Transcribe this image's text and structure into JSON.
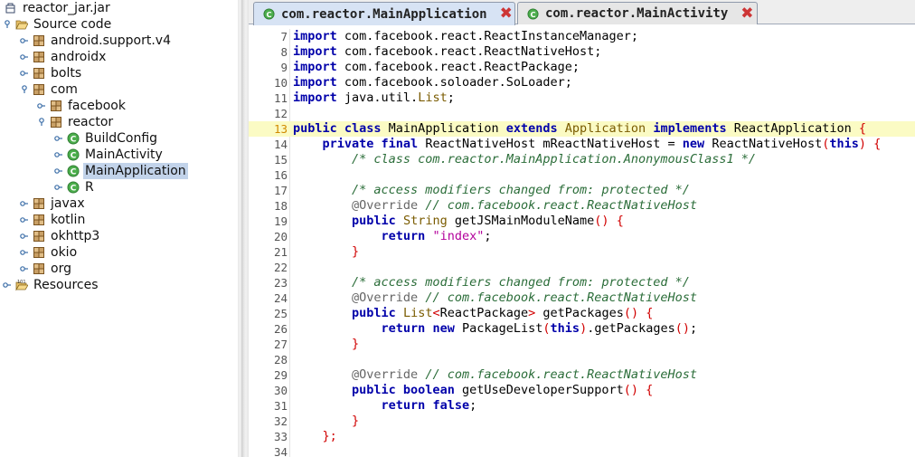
{
  "project_tree": {
    "nodes": [
      {
        "label": "reactor_jar.jar",
        "icon": "jar-icon",
        "depth": 0,
        "toggle": "none",
        "selected": false
      },
      {
        "label": "Source code",
        "icon": "folder-open-icon",
        "depth": 1,
        "toggle": "expanded",
        "selected": false
      },
      {
        "label": "android.support.v4",
        "icon": "package-icon",
        "depth": 2,
        "toggle": "collapsed",
        "selected": false
      },
      {
        "label": "androidx",
        "icon": "package-icon",
        "depth": 2,
        "toggle": "collapsed",
        "selected": false
      },
      {
        "label": "bolts",
        "icon": "package-icon",
        "depth": 2,
        "toggle": "collapsed",
        "selected": false
      },
      {
        "label": "com",
        "icon": "package-icon",
        "depth": 2,
        "toggle": "expanded",
        "selected": false
      },
      {
        "label": "facebook",
        "icon": "package-icon",
        "depth": 3,
        "toggle": "collapsed",
        "selected": false
      },
      {
        "label": "reactor",
        "icon": "package-icon",
        "depth": 3,
        "toggle": "expanded",
        "selected": false
      },
      {
        "label": "BuildConfig",
        "icon": "class-icon",
        "depth": 4,
        "toggle": "collapsed",
        "selected": false
      },
      {
        "label": "MainActivity",
        "icon": "class-icon",
        "depth": 4,
        "toggle": "collapsed",
        "selected": false
      },
      {
        "label": "MainApplication",
        "icon": "class-icon",
        "depth": 4,
        "toggle": "collapsed",
        "selected": true
      },
      {
        "label": "R",
        "icon": "class-icon",
        "depth": 4,
        "toggle": "collapsed",
        "selected": false
      },
      {
        "label": "javax",
        "icon": "package-icon",
        "depth": 2,
        "toggle": "collapsed",
        "selected": false
      },
      {
        "label": "kotlin",
        "icon": "package-icon",
        "depth": 2,
        "toggle": "collapsed",
        "selected": false
      },
      {
        "label": "okhttp3",
        "icon": "package-icon",
        "depth": 2,
        "toggle": "collapsed",
        "selected": false
      },
      {
        "label": "okio",
        "icon": "package-icon",
        "depth": 2,
        "toggle": "collapsed",
        "selected": false
      },
      {
        "label": "org",
        "icon": "package-icon",
        "depth": 2,
        "toggle": "collapsed",
        "selected": false
      },
      {
        "label": "Resources",
        "icon": "resources-folder-icon",
        "depth": 1,
        "toggle": "collapsed",
        "selected": false
      }
    ]
  },
  "editor": {
    "tabs": [
      {
        "label": "com.reactor.MainApplication",
        "icon": "class-icon",
        "close_icon": "close-icon",
        "active": true
      },
      {
        "label": "com.reactor.MainActivity",
        "icon": "class-icon",
        "close_icon": "close-icon",
        "active": false
      }
    ],
    "highlight_line": 13,
    "lines": [
      {
        "n": "7",
        "tokens": [
          [
            "keyword",
            "import"
          ],
          [
            "plain",
            " com.facebook.react.ReactInstanceManager;"
          ]
        ]
      },
      {
        "n": "8",
        "tokens": [
          [
            "keyword",
            "import"
          ],
          [
            "plain",
            " com.facebook.react.ReactNativeHost;"
          ]
        ]
      },
      {
        "n": "9",
        "tokens": [
          [
            "keyword",
            "import"
          ],
          [
            "plain",
            " com.facebook.react.ReactPackage;"
          ]
        ]
      },
      {
        "n": "10",
        "tokens": [
          [
            "keyword",
            "import"
          ],
          [
            "plain",
            " com.facebook.soloader.SoLoader;"
          ]
        ]
      },
      {
        "n": "11",
        "tokens": [
          [
            "keyword",
            "import"
          ],
          [
            "plain",
            " java.util."
          ],
          [
            "type",
            "List"
          ],
          [
            "plain",
            ";"
          ]
        ]
      },
      {
        "n": "12",
        "tokens": []
      },
      {
        "n": "13",
        "tokens": [
          [
            "keyword",
            "public class"
          ],
          [
            "plain",
            " MainApplication "
          ],
          [
            "keyword",
            "extends"
          ],
          [
            "plain",
            " "
          ],
          [
            "type",
            "Application"
          ],
          [
            "plain",
            " "
          ],
          [
            "keyword",
            "implements"
          ],
          [
            "plain",
            " ReactApplication "
          ],
          [
            "punct",
            "{"
          ]
        ]
      },
      {
        "n": "14",
        "tokens": [
          [
            "plain",
            "    "
          ],
          [
            "keyword",
            "private final"
          ],
          [
            "plain",
            " ReactNativeHost mReactNativeHost = "
          ],
          [
            "keyword",
            "new"
          ],
          [
            "plain",
            " ReactNativeHost"
          ],
          [
            "punct",
            "("
          ],
          [
            "keyword",
            "this"
          ],
          [
            "punct",
            ")"
          ],
          [
            "plain",
            " "
          ],
          [
            "punct",
            "{"
          ]
        ]
      },
      {
        "n": "15",
        "tokens": [
          [
            "plain",
            "        "
          ],
          [
            "comment",
            "/* class com.reactor.MainApplication.AnonymousClass1 */"
          ]
        ]
      },
      {
        "n": "16",
        "tokens": []
      },
      {
        "n": "17",
        "tokens": [
          [
            "plain",
            "        "
          ],
          [
            "comment",
            "/* access modifiers changed from: protected */"
          ]
        ]
      },
      {
        "n": "18",
        "tokens": [
          [
            "plain",
            "        "
          ],
          [
            "annotation",
            "@Override"
          ],
          [
            "plain",
            " "
          ],
          [
            "comment",
            "// com.facebook.react.ReactNativeHost"
          ]
        ]
      },
      {
        "n": "19",
        "tokens": [
          [
            "plain",
            "        "
          ],
          [
            "keyword",
            "public"
          ],
          [
            "plain",
            " "
          ],
          [
            "type",
            "String"
          ],
          [
            "plain",
            " getJSMainModuleName"
          ],
          [
            "punct",
            "()"
          ],
          [
            "plain",
            " "
          ],
          [
            "punct",
            "{"
          ]
        ]
      },
      {
        "n": "20",
        "tokens": [
          [
            "plain",
            "            "
          ],
          [
            "keyword",
            "return"
          ],
          [
            "plain",
            " "
          ],
          [
            "string",
            "\"index\""
          ],
          [
            "plain",
            ";"
          ]
        ]
      },
      {
        "n": "21",
        "tokens": [
          [
            "plain",
            "        "
          ],
          [
            "punct",
            "}"
          ]
        ]
      },
      {
        "n": "22",
        "tokens": []
      },
      {
        "n": "23",
        "tokens": [
          [
            "plain",
            "        "
          ],
          [
            "comment",
            "/* access modifiers changed from: protected */"
          ]
        ]
      },
      {
        "n": "24",
        "tokens": [
          [
            "plain",
            "        "
          ],
          [
            "annotation",
            "@Override"
          ],
          [
            "plain",
            " "
          ],
          [
            "comment",
            "// com.facebook.react.ReactNativeHost"
          ]
        ]
      },
      {
        "n": "25",
        "tokens": [
          [
            "plain",
            "        "
          ],
          [
            "keyword",
            "public"
          ],
          [
            "plain",
            " "
          ],
          [
            "type",
            "List"
          ],
          [
            "punct",
            "<"
          ],
          [
            "plain",
            "ReactPackage"
          ],
          [
            "punct",
            ">"
          ],
          [
            "plain",
            " getPackages"
          ],
          [
            "punct",
            "()"
          ],
          [
            "plain",
            " "
          ],
          [
            "punct",
            "{"
          ]
        ]
      },
      {
        "n": "26",
        "tokens": [
          [
            "plain",
            "            "
          ],
          [
            "keyword",
            "return"
          ],
          [
            "plain",
            " "
          ],
          [
            "keyword",
            "new"
          ],
          [
            "plain",
            " PackageList"
          ],
          [
            "punct",
            "("
          ],
          [
            "keyword",
            "this"
          ],
          [
            "punct",
            ")"
          ],
          [
            "plain",
            ".getPackages"
          ],
          [
            "punct",
            "()"
          ],
          [
            "plain",
            ";"
          ]
        ]
      },
      {
        "n": "27",
        "tokens": [
          [
            "plain",
            "        "
          ],
          [
            "punct",
            "}"
          ]
        ]
      },
      {
        "n": "28",
        "tokens": []
      },
      {
        "n": "29",
        "tokens": [
          [
            "plain",
            "        "
          ],
          [
            "annotation",
            "@Override"
          ],
          [
            "plain",
            " "
          ],
          [
            "comment",
            "// com.facebook.react.ReactNativeHost"
          ]
        ]
      },
      {
        "n": "30",
        "tokens": [
          [
            "plain",
            "        "
          ],
          [
            "keyword",
            "public boolean"
          ],
          [
            "plain",
            " getUseDeveloperSupport"
          ],
          [
            "punct",
            "()"
          ],
          [
            "plain",
            " "
          ],
          [
            "punct",
            "{"
          ]
        ]
      },
      {
        "n": "31",
        "tokens": [
          [
            "plain",
            "            "
          ],
          [
            "keyword",
            "return false"
          ],
          [
            "plain",
            ";"
          ]
        ]
      },
      {
        "n": "32",
        "tokens": [
          [
            "plain",
            "        "
          ],
          [
            "punct",
            "}"
          ]
        ]
      },
      {
        "n": "33",
        "tokens": [
          [
            "plain",
            "    "
          ],
          [
            "punct",
            "};"
          ]
        ]
      },
      {
        "n": "34",
        "tokens": []
      }
    ]
  }
}
